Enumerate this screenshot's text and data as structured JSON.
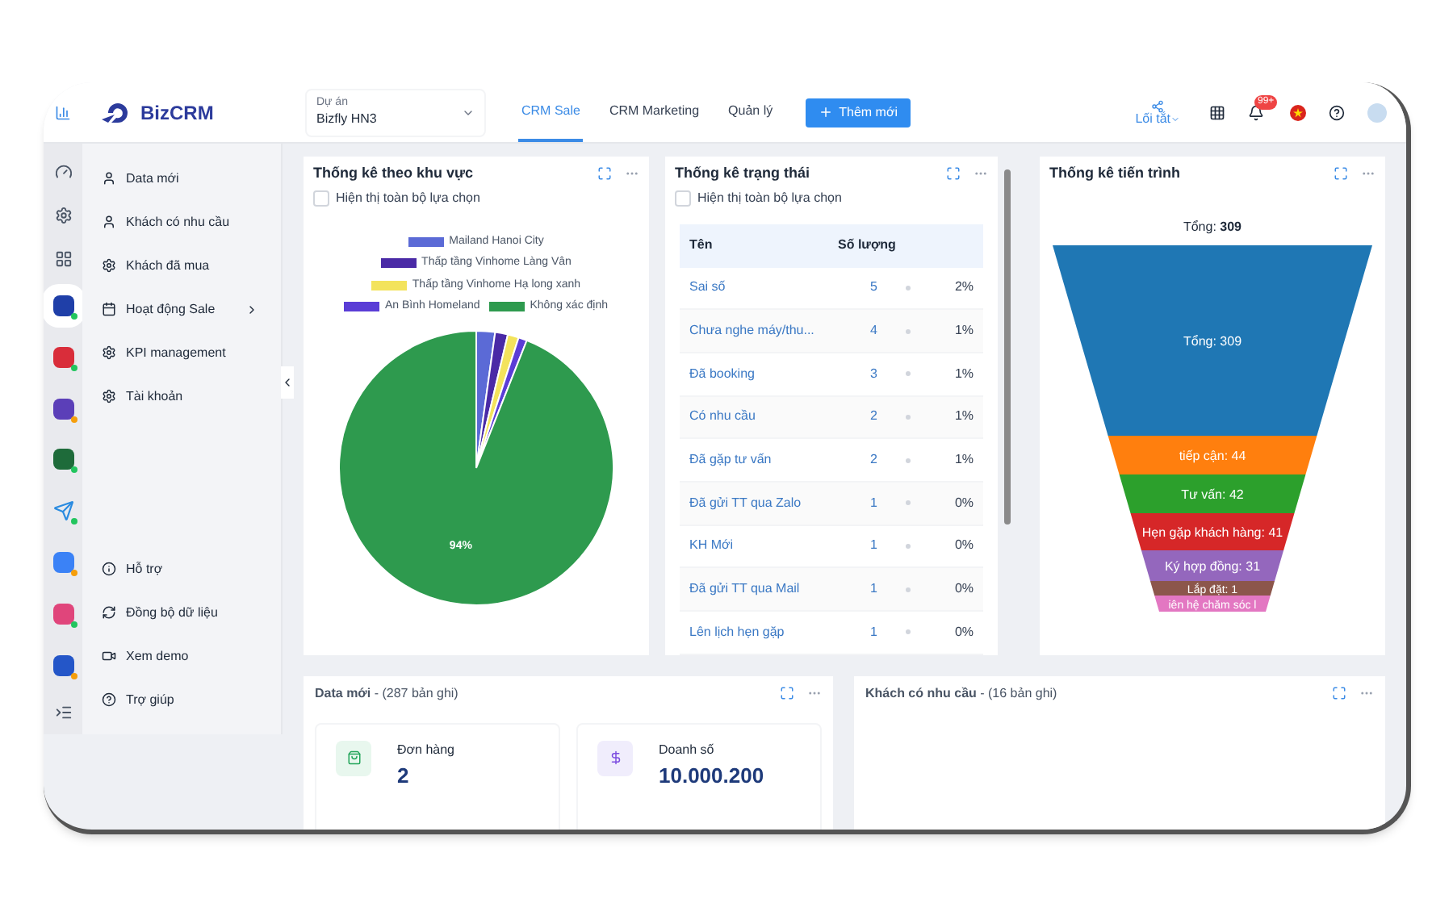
{
  "topbar": {
    "logo": "BizCRM",
    "project_label": "Dự án",
    "project_value": "Bizfly HN3",
    "tabs": [
      {
        "label": "CRM Sale",
        "selected": true
      },
      {
        "label": "CRM Marketing",
        "selected": false
      },
      {
        "label": "Quản lý",
        "selected": false
      }
    ],
    "add_button": "Thêm mới",
    "shortcut": "Lối tắt",
    "notification_badge": "99+"
  },
  "rail": [
    {
      "kind": "tool"
    },
    {
      "kind": "tool"
    },
    {
      "kind": "tool"
    },
    {
      "kind": "app",
      "color": "#22c55e",
      "selected": true
    },
    {
      "kind": "app",
      "color": "#22c55e",
      "selected": false
    },
    {
      "kind": "app",
      "color": "#f59e0b",
      "selected": false
    },
    {
      "kind": "app",
      "color": "#22c55e",
      "selected": false
    },
    {
      "kind": "plane",
      "color": "#22c55e",
      "selected": false
    },
    {
      "kind": "app",
      "color": "#f59e0b",
      "selected": false
    },
    {
      "kind": "app",
      "color": "#22c55e",
      "selected": false
    },
    {
      "kind": "app",
      "color": "#f59e0b",
      "selected": false
    },
    {
      "kind": "tool"
    }
  ],
  "sidebar": {
    "items": [
      {
        "label": "Data mới",
        "has_children": false
      },
      {
        "label": "Khách có nhu cầu",
        "has_children": false
      },
      {
        "label": "Khách đã mua",
        "has_children": false
      },
      {
        "label": "Hoạt động Sale",
        "has_children": true
      },
      {
        "label": "KPI management",
        "has_children": false
      },
      {
        "label": "Tài khoản",
        "has_children": false
      }
    ],
    "footer_items": [
      {
        "label": "Hỗ trợ"
      },
      {
        "label": "Đồng bộ dữ liệu"
      },
      {
        "label": "Xem demo"
      },
      {
        "label": "Trợ giúp"
      }
    ]
  },
  "region_panel": {
    "title": "Thống kê theo khu vực",
    "show_all": "Hiện thị toàn bộ lựa chọn",
    "show_all_checked": false,
    "chart_data": {
      "type": "pie",
      "categories": [
        "Mailand Hanoi City",
        "Thấp tầng Vinhome Làng Vân",
        "Thấp tầng Vinhome Hạ long xanh",
        "An Bình Homeland",
        "Không xác định"
      ],
      "values": [
        2.2,
        1.5,
        1.3,
        1,
        94
      ],
      "value_labels": [
        null,
        null,
        null,
        null,
        "94%"
      ]
    }
  },
  "status_panel": {
    "title": "Thống kê trạng thái",
    "show_all": "Hiện thị toàn bộ lựa chọn",
    "show_all_checked": false,
    "columns": [
      "Tên",
      "Số lượng"
    ],
    "rows": [
      {
        "name": "Sai số",
        "count": "5",
        "percent": "2%"
      },
      {
        "name": "Chưa nghe máy/thu...",
        "count": "4",
        "percent": "1%"
      },
      {
        "name": "Đã booking",
        "count": "3",
        "percent": "1%"
      },
      {
        "name": "Có nhu cầu",
        "count": "2",
        "percent": "1%"
      },
      {
        "name": "Đã gặp tư vấn",
        "count": "2",
        "percent": "1%"
      },
      {
        "name": "Đã gửi TT qua Zalo",
        "count": "1",
        "percent": "0%"
      },
      {
        "name": "KH Mới",
        "count": "1",
        "percent": "0%"
      },
      {
        "name": "Đã gửi TT qua Mail",
        "count": "1",
        "percent": "0%"
      },
      {
        "name": "Lên lịch hẹn gặp",
        "count": "1",
        "percent": "0%"
      }
    ]
  },
  "progress_panel": {
    "title": "Thống kê tiến trình",
    "total": "Tổng: **309**",
    "stages": [
      {
        "label": "Tổng: 309",
        "color": "#1f77b4"
      },
      {
        "label": "tiếp cận: 44",
        "color": "#ff7f0e"
      },
      {
        "label": "Tư vấn: 42",
        "color": "#2ca02c"
      },
      {
        "label": "Hẹn gặp khách hàng: 41",
        "color": "#d62728"
      },
      {
        "label": "Ký hợp đồng: 31",
        "color": "#9467bd"
      },
      {
        "label": "Lắp đặt: 1",
        "color": "#8c564b"
      },
      {
        "label": "iên hệ chăm sóc l",
        "color": "#e377c2"
      }
    ]
  },
  "new_data_panel": {
    "title": "**Data mới** - (287 bản ghi)",
    "cards": [
      {
        "label": "Đơn hàng",
        "value": "2",
        "kind": "order"
      },
      {
        "label": "Doanh số",
        "value": "10.000.200",
        "kind": "revenue"
      }
    ]
  },
  "demand_panel": {
    "title": "**Khách có nhu cầu** - (16 bản ghi)"
  }
}
